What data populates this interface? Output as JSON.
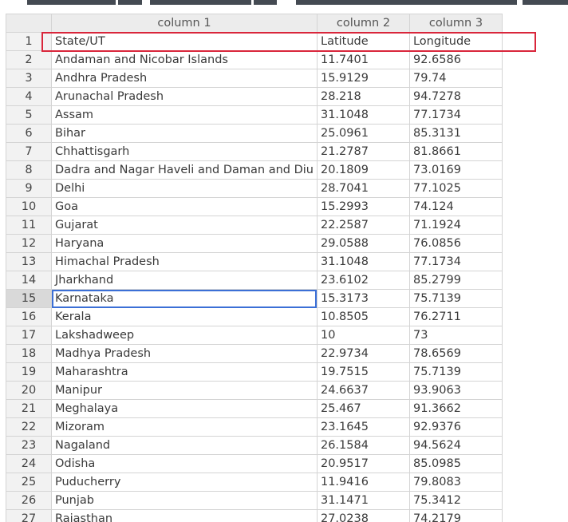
{
  "grid": {
    "columns": [
      "",
      "column 1",
      "column 2",
      "column 3"
    ],
    "active_row": 15,
    "rows": [
      {
        "n": "1",
        "c1": "State/UT",
        "c2": "Latitude",
        "c3": "Longitude"
      },
      {
        "n": "2",
        "c1": "Andaman and Nicobar Islands",
        "c2": "11.7401",
        "c3": "92.6586"
      },
      {
        "n": "3",
        "c1": "Andhra Pradesh",
        "c2": "15.9129",
        "c3": "79.74"
      },
      {
        "n": "4",
        "c1": "Arunachal Pradesh",
        "c2": "28.218",
        "c3": "94.7278"
      },
      {
        "n": "5",
        "c1": "Assam",
        "c2": "31.1048",
        "c3": "77.1734"
      },
      {
        "n": "6",
        "c1": "Bihar",
        "c2": "25.0961",
        "c3": "85.3131"
      },
      {
        "n": "7",
        "c1": "Chhattisgarh",
        "c2": "21.2787",
        "c3": "81.8661"
      },
      {
        "n": "8",
        "c1": "Dadra and Nagar Haveli and Daman and Diu",
        "c2": "20.1809",
        "c3": "73.0169"
      },
      {
        "n": "9",
        "c1": "Delhi",
        "c2": "28.7041",
        "c3": "77.1025"
      },
      {
        "n": "10",
        "c1": "Goa",
        "c2": "15.2993",
        "c3": "74.124"
      },
      {
        "n": "11",
        "c1": "Gujarat",
        "c2": "22.2587",
        "c3": "71.1924"
      },
      {
        "n": "12",
        "c1": "Haryana",
        "c2": "29.0588",
        "c3": "76.0856"
      },
      {
        "n": "13",
        "c1": "Himachal Pradesh",
        "c2": "31.1048",
        "c3": "77.1734"
      },
      {
        "n": "14",
        "c1": "Jharkhand",
        "c2": "23.6102",
        "c3": "85.2799"
      },
      {
        "n": "15",
        "c1": "Karnataka",
        "c2": "15.3173",
        "c3": "75.7139"
      },
      {
        "n": "16",
        "c1": "Kerala",
        "c2": "10.8505",
        "c3": "76.2711"
      },
      {
        "n": "17",
        "c1": "Lakshadweep",
        "c2": "10",
        "c3": "73"
      },
      {
        "n": "18",
        "c1": "Madhya Pradesh",
        "c2": "22.9734",
        "c3": "78.6569"
      },
      {
        "n": "19",
        "c1": "Maharashtra",
        "c2": "19.7515",
        "c3": "75.7139"
      },
      {
        "n": "20",
        "c1": "Manipur",
        "c2": "24.6637",
        "c3": "93.9063"
      },
      {
        "n": "21",
        "c1": "Meghalaya",
        "c2": "25.467",
        "c3": "91.3662"
      },
      {
        "n": "22",
        "c1": "Mizoram",
        "c2": "23.1645",
        "c3": "92.9376"
      },
      {
        "n": "23",
        "c1": "Nagaland",
        "c2": "26.1584",
        "c3": "94.5624"
      },
      {
        "n": "24",
        "c1": "Odisha",
        "c2": "20.9517",
        "c3": "85.0985"
      },
      {
        "n": "25",
        "c1": "Puducherry",
        "c2": "11.9416",
        "c3": "79.8083"
      },
      {
        "n": "26",
        "c1": "Punjab",
        "c2": "31.1471",
        "c3": "75.3412"
      },
      {
        "n": "27",
        "c1": "Rajasthan",
        "c2": "27.0238",
        "c3": "74.2179"
      }
    ]
  },
  "colors": {
    "highlight": "#d9263b",
    "active_cell_border": "#3b6fd6"
  }
}
